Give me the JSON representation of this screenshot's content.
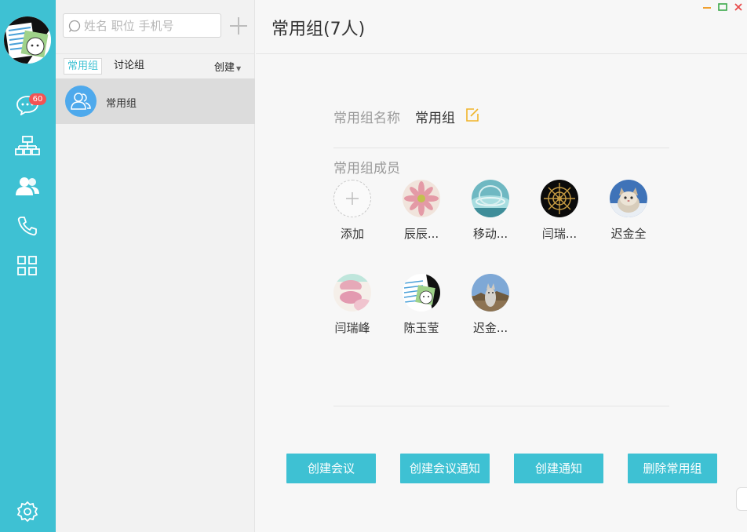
{
  "nav": {
    "unread_count": "60",
    "icons": [
      "chat-icon",
      "org-chart-icon",
      "contacts-icon",
      "phone-icon",
      "apps-grid-icon",
      "settings-icon"
    ],
    "accent": "#3ec1d3",
    "badge_color": "#f25353"
  },
  "sidebar": {
    "search_placeholder": "姓名 职位 手机号",
    "tabs": [
      "常用组",
      "讨论组"
    ],
    "active_tab": "常用组",
    "create_label": "创建",
    "groups": [
      {
        "name": "常用组"
      }
    ]
  },
  "main": {
    "title": "常用组(7人)",
    "group_name_label": "常用组名称",
    "group_name_value": "常用组",
    "members_label": "常用组成员",
    "add_label": "添加",
    "members": [
      {
        "name": "辰辰...",
        "avatar": "flower"
      },
      {
        "name": "移动...",
        "avatar": "water"
      },
      {
        "name": "闫瑞...",
        "avatar": "compass"
      },
      {
        "name": "迟金全",
        "avatar": "cat"
      },
      {
        "name": "闫瑞峰",
        "avatar": "macaron"
      },
      {
        "name": "陈玉莹",
        "avatar": "cartoon"
      },
      {
        "name": "迟金...",
        "avatar": "wolf"
      }
    ],
    "buttons": {
      "create_meeting": "创建会议",
      "create_meeting_notice": "创建会议通知",
      "create_notice": "创建通知",
      "delete_group": "删除常用组"
    }
  }
}
